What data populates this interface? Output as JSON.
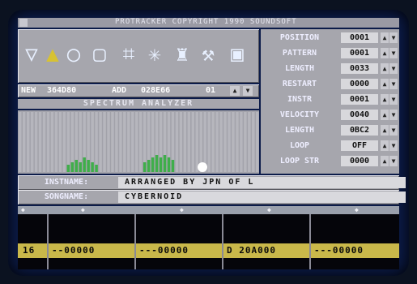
{
  "title": "PROTRACKER  COPYRIGHT 1990 SOUNDSOFT",
  "toolbar": {
    "icons": [
      "filter-icon",
      "tuner-icon",
      "ear-icon",
      "monitor-icon",
      "disk-op-icon",
      "preset-icon",
      "sample-edit-icon",
      "wrench-icon",
      "disk-icon"
    ]
  },
  "rows": [
    {
      "label": "POSITION",
      "value": "0001"
    },
    {
      "label": "PATTERN",
      "value": "0001"
    },
    {
      "label": "LENGTH",
      "value": "0033"
    },
    {
      "label": "RESTART",
      "value": "0000"
    },
    {
      "label": "INSTR",
      "value": "0001"
    },
    {
      "label": "VELOCITY",
      "value": "0040"
    },
    {
      "label": "LENGTH",
      "value": "0BC2"
    },
    {
      "label": "LOOP",
      "value": "OFF"
    },
    {
      "label": "LOOP STR",
      "value": "0000"
    }
  ],
  "memory": {
    "new": "NEW",
    "new_val": "364D80",
    "add": "ADD",
    "add_val": "028E66",
    "num": "01"
  },
  "spectrum": {
    "title": "SPECTRUM ANALYZER",
    "levels": [
      0,
      0,
      0,
      0,
      0,
      0,
      0,
      0,
      0,
      0,
      0,
      0,
      3,
      4,
      5,
      4,
      6,
      5,
      4,
      3,
      0,
      0,
      0,
      0,
      0,
      0,
      0,
      0,
      0,
      0,
      0,
      4,
      5,
      6,
      7,
      6,
      7,
      6,
      5,
      0,
      0,
      0,
      0,
      0,
      0,
      0,
      0,
      0,
      0,
      0,
      0,
      0,
      0,
      0,
      0,
      0,
      0,
      0,
      0,
      0
    ]
  },
  "instname": {
    "label": "INSTNAME:",
    "value": "ARRANGED BY JPN OF L"
  },
  "songname": {
    "label": "SONGNAME:",
    "value": "CYBERNOID"
  },
  "tracks": [
    {
      "row": "16",
      "cells": [
        "--00000",
        "---00000",
        "D 20A000",
        "---00000"
      ]
    }
  ]
}
